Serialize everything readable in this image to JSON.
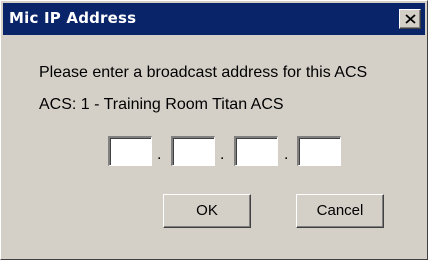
{
  "window": {
    "title": "Mic IP Address",
    "close_glyph": "X"
  },
  "dialog": {
    "prompt": "Please enter a broadcast address for this ACS",
    "acs_line": "ACS: 1 - Training Room Titan ACS",
    "ip_octets": [
      "",
      "",
      "",
      ""
    ],
    "separator": "."
  },
  "buttons": {
    "ok_label": "OK",
    "cancel_label": "Cancel"
  },
  "colors": {
    "titlebar": "#0a246a",
    "face": "#d4d0c8"
  }
}
